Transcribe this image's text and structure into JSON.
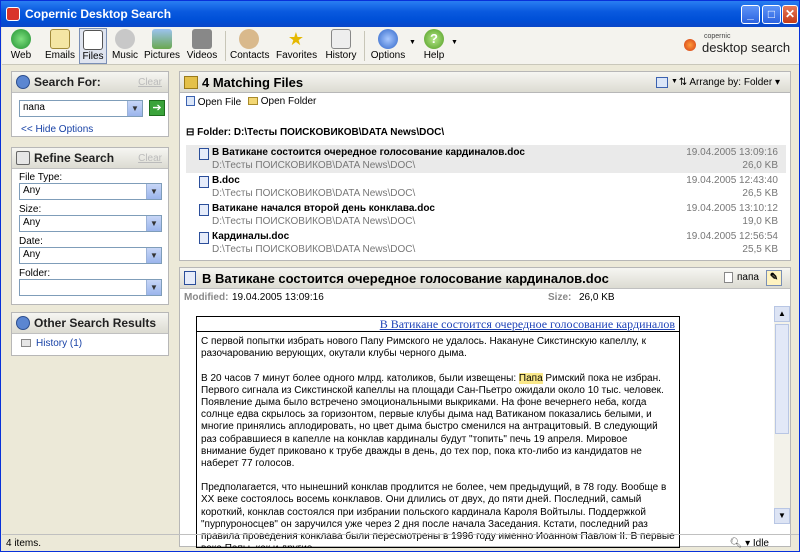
{
  "window": {
    "title": "Copernic Desktop Search"
  },
  "toolbar": {
    "items": [
      "Web",
      "Emails",
      "Files",
      "Music",
      "Pictures",
      "Videos",
      "Contacts",
      "Favorites",
      "History",
      "Options",
      "Help"
    ],
    "logo_small": "copernic",
    "logo_text": "desktop search"
  },
  "search": {
    "header": "Search For:",
    "clear": "Clear",
    "query": "папа",
    "hide_options": "<< Hide Options"
  },
  "refine": {
    "header": "Refine Search",
    "clear": "Clear",
    "file_type_label": "File Type:",
    "file_type_value": "Any",
    "size_label": "Size:",
    "size_value": "Any",
    "date_label": "Date:",
    "date_value": "Any",
    "folder_label": "Folder:",
    "folder_value": ""
  },
  "other": {
    "header": "Other Search Results",
    "history": "History (1)"
  },
  "results": {
    "header": "4 Matching Files",
    "arrange": "Arrange by: Folder",
    "open_file": "Open File",
    "open_folder": "Open Folder",
    "folder": "Folder: D:\\Тесты ПОИСКОВИКОВ\\DATA News\\DOC\\",
    "files": [
      {
        "name": "В Ватикане состоится очередное голосование кардиналов.doc",
        "path": "D:\\Тесты ПОИСКОВИКОВ\\DATA News\\DOC\\",
        "date": "19.04.2005 13:09:16",
        "size": "26,0 KB"
      },
      {
        "name": "B.doc",
        "path": "D:\\Тесты ПОИСКОВИКОВ\\DATA News\\DOC\\",
        "date": "19.04.2005 12:43:40",
        "size": "26,5 KB"
      },
      {
        "name": "Ватикане начался второй день конклава.doc",
        "path": "D:\\Тесты ПОИСКОВИКОВ\\DATA News\\DOC\\",
        "date": "19.04.2005 13:10:12",
        "size": "19,0 KB"
      },
      {
        "name": "Кардиналы.doc",
        "path": "D:\\Тесты ПОИСКОВИКОВ\\DATA News\\DOC\\",
        "date": "19.04.2005 12:56:54",
        "size": "25,5 KB"
      }
    ]
  },
  "preview": {
    "title": "В Ватикане состоится очередное голосование кардиналов.doc",
    "tag": "папа",
    "modified_label": "Modified:",
    "modified": "19.04.2005 13:09:16",
    "size_label": "Size:",
    "size": "26,0 KB",
    "doc_title": "В Ватикане состоится очередное голосование кардиналов",
    "p1": "С первой попытки избрать нового Папу Римского не удалось. Накануне Сикстинскую капеллу, к разочарованию верующих, окутали клубы черного дыма.",
    "p2a": "В 20 часов 7 минут более одного млрд. католиков, были извещены: ",
    "p2hl": "Папа",
    "p2b": " Римский пока не избран. Первого сигнала из Сикстинской капеллы на площади Сан-Пьетро ожидали около 10 тыс. человек. Появление дыма было встречено эмоциональными выкриками. На фоне вечернего неба, когда солнце едва скрылось за горизонтом, первые клубы дыма над Ватиканом показались белыми, и многие принялись аплодировать, но цвет дыма быстро сменился на антрацитовый. В следующий раз собравшиеся в капелле на конклав кардиналы будут \"топить\" печь 19 апреля. Мировое внимание будет приковано к трубе дважды в день, до тех пор, пока кто-либо из кандидатов не наберет 77 голосов.",
    "p3": "Предполагается, что нынешний конклав продлится не более, чем предыдущий, в 78 году. Вообще в XX веке состоялось восемь конклавов. Они длились от двух, до пяти дней. Последний, самый короткий, конклав состоялся при избрании польского кардинала Кароля Войтылы. Поддержкой \"пурпуроносцев\" он заручился уже через 2 дня после начала Заседания. Кстати, последний раз правила проведения конклава были пересмотрены в 1996 году именно Иоанном Павлом II. В первые века Папы, как и другие"
  },
  "status": {
    "left": "4 items.",
    "right": "Idle"
  }
}
